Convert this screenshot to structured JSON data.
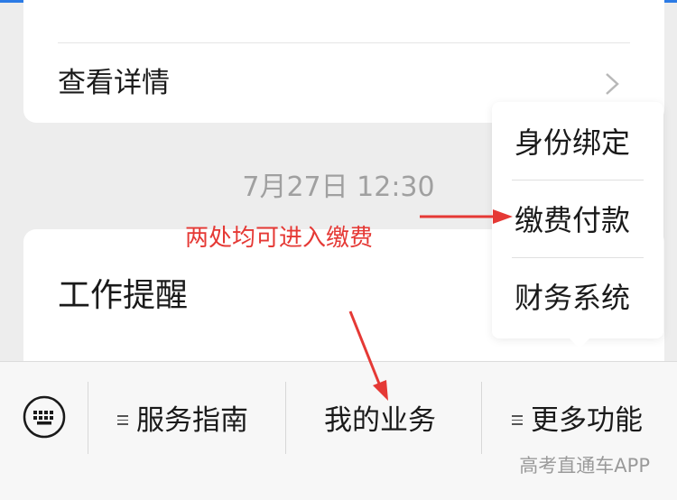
{
  "top_card": {
    "detail_label": "查看详情"
  },
  "timestamp": "7月27日 12:30",
  "reminder_card": {
    "title": "工作提醒"
  },
  "annotation": {
    "text": "两处均可进入缴费",
    "color": "#e53935"
  },
  "popup_menu": {
    "items": [
      {
        "label": "身份绑定"
      },
      {
        "label": "缴费付款"
      },
      {
        "label": "财务系统"
      }
    ]
  },
  "bottom_bar": {
    "tabs": [
      {
        "label": "服务指南",
        "has_menu_icon": true
      },
      {
        "label": "我的业务",
        "has_menu_icon": false
      },
      {
        "label": "更多功能",
        "has_menu_icon": true
      }
    ],
    "keyboard_icon": "keyboard-icon"
  },
  "watermark": "高考直通车APP"
}
